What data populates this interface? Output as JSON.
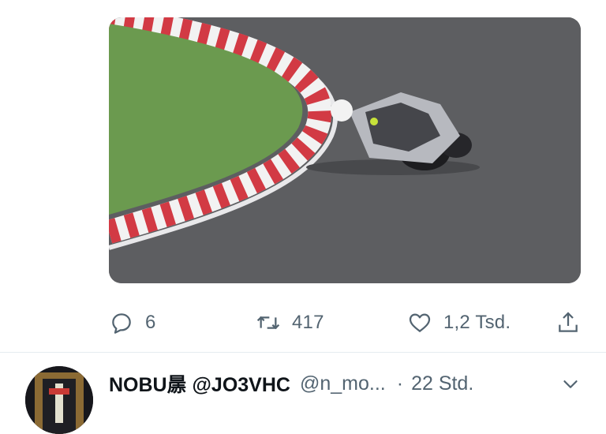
{
  "media": {
    "kind": "video-frame",
    "subject": "motorcycle-on-race-track"
  },
  "actions": {
    "reply": {
      "icon": "reply-icon",
      "count": "6"
    },
    "retweet": {
      "icon": "retweet-icon",
      "count": "417"
    },
    "like": {
      "icon": "heart-icon",
      "count": "1,2 Tsd."
    },
    "share": {
      "icon": "share-icon"
    }
  },
  "next_tweet": {
    "display_name": "NOBU㬄 @JO3VHC",
    "handle": "@n_mo...",
    "separator": "·",
    "time": "22 Std.",
    "menu_icon": "chevron-down-icon"
  },
  "colors": {
    "icon_gray": "#536471",
    "divider": "#e6ecf0",
    "text": "#0f1419"
  }
}
